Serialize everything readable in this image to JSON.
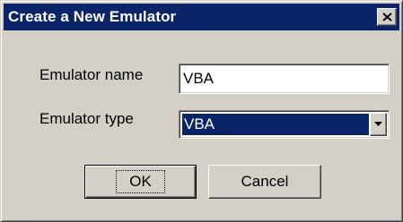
{
  "window": {
    "title": "Create a New Emulator",
    "close_icon": "close-icon"
  },
  "form": {
    "name_label": "Emulator name",
    "name_value": "VBA",
    "type_label": "Emulator type",
    "type_selected": "VBA",
    "dropdown_icon": "chevron-down-icon"
  },
  "buttons": {
    "ok_label": "OK",
    "cancel_label": "Cancel"
  },
  "colors": {
    "titlebar": "#0a246a",
    "dialog_face": "#d4d0c8",
    "selection": "#0a246a"
  }
}
